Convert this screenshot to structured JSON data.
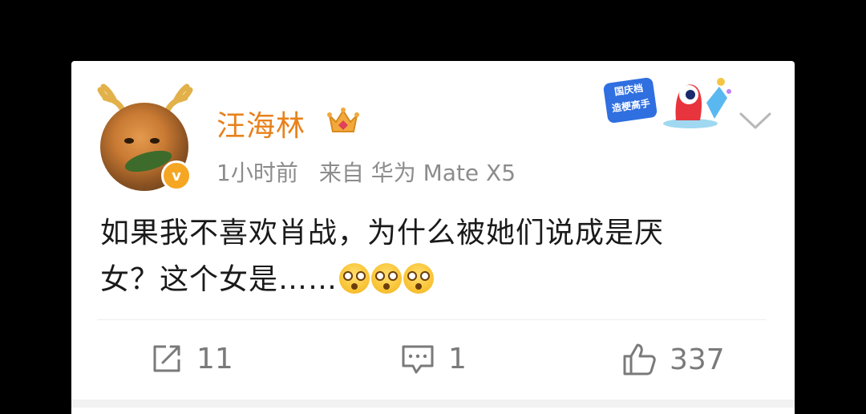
{
  "post": {
    "username": "汪海林",
    "time": "1小时前",
    "source": "来自 华为 Mate X5",
    "content_line1": "如果我不喜欢肖战，为什么被她们说成是厌",
    "content_line2": "女？这个女是……",
    "emoji_name": "dizzy-face-emoji",
    "promo_badge": {
      "line1": "国庆档",
      "line2": "造梗高手"
    }
  },
  "actions": {
    "repost_count": "11",
    "comment_count": "1",
    "like_count": "337"
  },
  "colors": {
    "username": "#e8811b",
    "meta": "#8c8c8c",
    "text": "#1a1a1a",
    "action": "#7a7a7a"
  }
}
